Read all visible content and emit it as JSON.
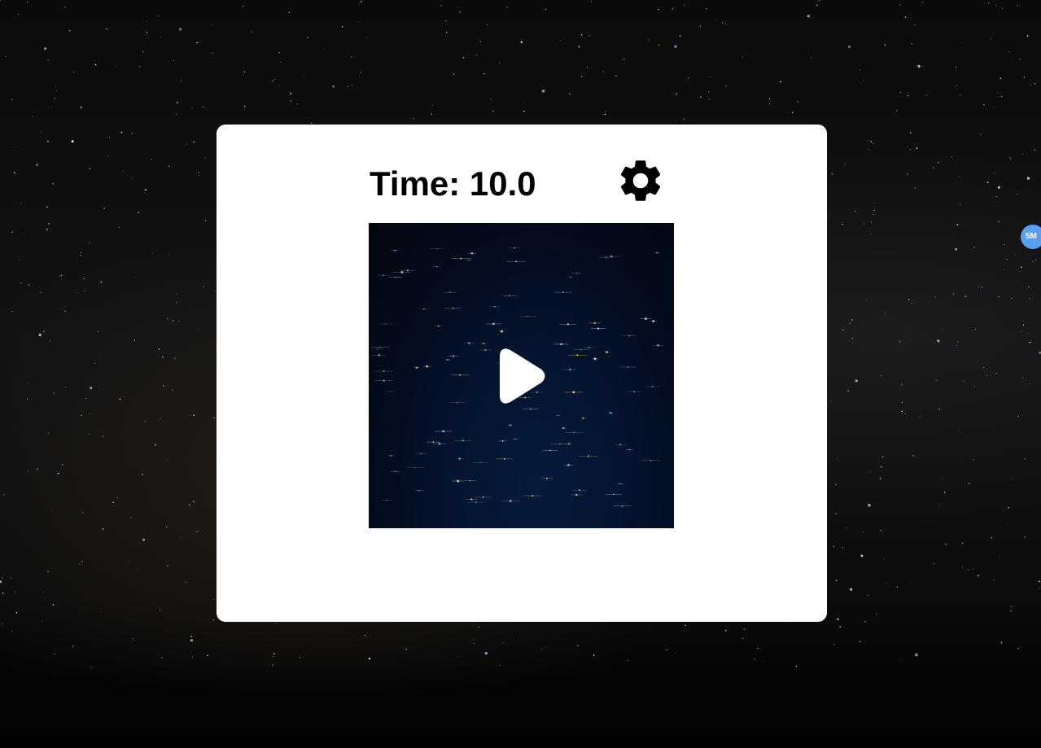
{
  "game": {
    "time_label": "Time: 10.0"
  },
  "icons": {
    "settings": "gear-icon",
    "play": "play-icon"
  },
  "side_badge": {
    "label": "5M",
    "color": "#5b9df1"
  },
  "colors": {
    "card": "#ffffff",
    "canvas": "#051430",
    "text": "#000000"
  }
}
